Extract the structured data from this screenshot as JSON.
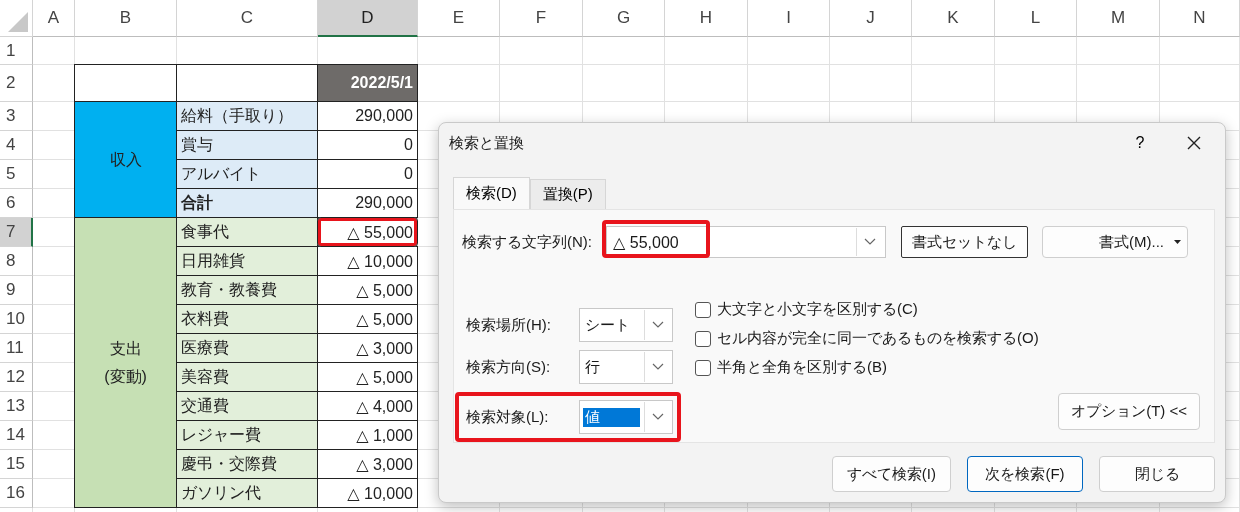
{
  "spreadsheet": {
    "columns": [
      {
        "label": "A",
        "selected": false
      },
      {
        "label": "B",
        "selected": false
      },
      {
        "label": "C",
        "selected": false
      },
      {
        "label": "D",
        "selected": true
      },
      {
        "label": "E",
        "selected": false
      },
      {
        "label": "F",
        "selected": false
      },
      {
        "label": "G",
        "selected": false
      },
      {
        "label": "H",
        "selected": false
      },
      {
        "label": "I",
        "selected": false
      },
      {
        "label": "J",
        "selected": false
      },
      {
        "label": "K",
        "selected": false
      },
      {
        "label": "L",
        "selected": false
      },
      {
        "label": "M",
        "selected": false
      },
      {
        "label": "N",
        "selected": false
      }
    ],
    "rows": [
      {
        "label": "1",
        "selected": false
      },
      {
        "label": "2",
        "selected": false
      },
      {
        "label": "3",
        "selected": false
      },
      {
        "label": "4",
        "selected": false
      },
      {
        "label": "5",
        "selected": false
      },
      {
        "label": "6",
        "selected": false
      },
      {
        "label": "7",
        "selected": true
      },
      {
        "label": "8",
        "selected": false
      },
      {
        "label": "9",
        "selected": false
      },
      {
        "label": "10",
        "selected": false
      },
      {
        "label": "11",
        "selected": false
      },
      {
        "label": "12",
        "selected": false
      },
      {
        "label": "13",
        "selected": false
      },
      {
        "label": "14",
        "selected": false
      },
      {
        "label": "15",
        "selected": false
      },
      {
        "label": "16",
        "selected": false
      }
    ],
    "header_date": "2022/5/1",
    "groups": [
      {
        "label": "収入",
        "kind": "income",
        "items": [
          {
            "name": "給料（手取り）",
            "value": "290,000",
            "bold": false,
            "highlighted": false
          },
          {
            "name": "賞与",
            "value": "0",
            "bold": false,
            "highlighted": false
          },
          {
            "name": "アルバイト",
            "value": "0",
            "bold": false,
            "highlighted": false
          },
          {
            "name": "合計",
            "value": "290,000",
            "bold": true,
            "highlighted": false
          }
        ]
      },
      {
        "label": "支出\n(変動)",
        "kind": "expense",
        "items": [
          {
            "name": "食事代",
            "value": "△ 55,000",
            "bold": false,
            "highlighted": true
          },
          {
            "name": "日用雑貨",
            "value": "△ 10,000",
            "bold": false,
            "highlighted": false
          },
          {
            "name": "教育・教養費",
            "value": "△ 5,000",
            "bold": false,
            "highlighted": false
          },
          {
            "name": "衣料費",
            "value": "△ 5,000",
            "bold": false,
            "highlighted": false
          },
          {
            "name": "医療費",
            "value": "△ 3,000",
            "bold": false,
            "highlighted": false
          },
          {
            "name": "美容費",
            "value": "△ 5,000",
            "bold": false,
            "highlighted": false
          },
          {
            "name": "交通費",
            "value": "△ 4,000",
            "bold": false,
            "highlighted": false
          },
          {
            "name": "レジャー費",
            "value": "△ 1,000",
            "bold": false,
            "highlighted": false
          },
          {
            "name": "慶弔・交際費",
            "value": "△ 3,000",
            "bold": false,
            "highlighted": false
          },
          {
            "name": "ガソリン代",
            "value": "△ 10,000",
            "bold": false,
            "highlighted": false
          }
        ]
      }
    ]
  },
  "dialog": {
    "title": "検索と置換",
    "help": "?",
    "tabs": [
      {
        "label": "検索(D)",
        "selected": true
      },
      {
        "label": "置換(P)",
        "selected": false
      }
    ],
    "find": {
      "label": "検索する文字列(N):",
      "value": "△ 55,000",
      "highlighted": true
    },
    "no_format_button": "書式セットなし",
    "format_button": "書式(M)...",
    "selects": [
      {
        "label": "検索場所(H):",
        "value": "シート",
        "highlighted": false,
        "focused": false
      },
      {
        "label": "検索方向(S):",
        "value": "行",
        "highlighted": false,
        "focused": false
      },
      {
        "label": "検索対象(L):",
        "value": "値",
        "highlighted": true,
        "focused": true
      }
    ],
    "options": [
      {
        "label": "大文字と小文字を区別する(C)",
        "checked": false
      },
      {
        "label": "セル内容が完全に同一であるものを検索する(O)",
        "checked": false
      },
      {
        "label": "半角と全角を区別する(B)",
        "checked": false
      }
    ],
    "options_button": "オプション(T) <<",
    "buttons": [
      {
        "label": "すべて検索(I)",
        "default": false
      },
      {
        "label": "次を検索(F)",
        "default": true
      },
      {
        "label": "閉じる",
        "default": false
      }
    ]
  }
}
